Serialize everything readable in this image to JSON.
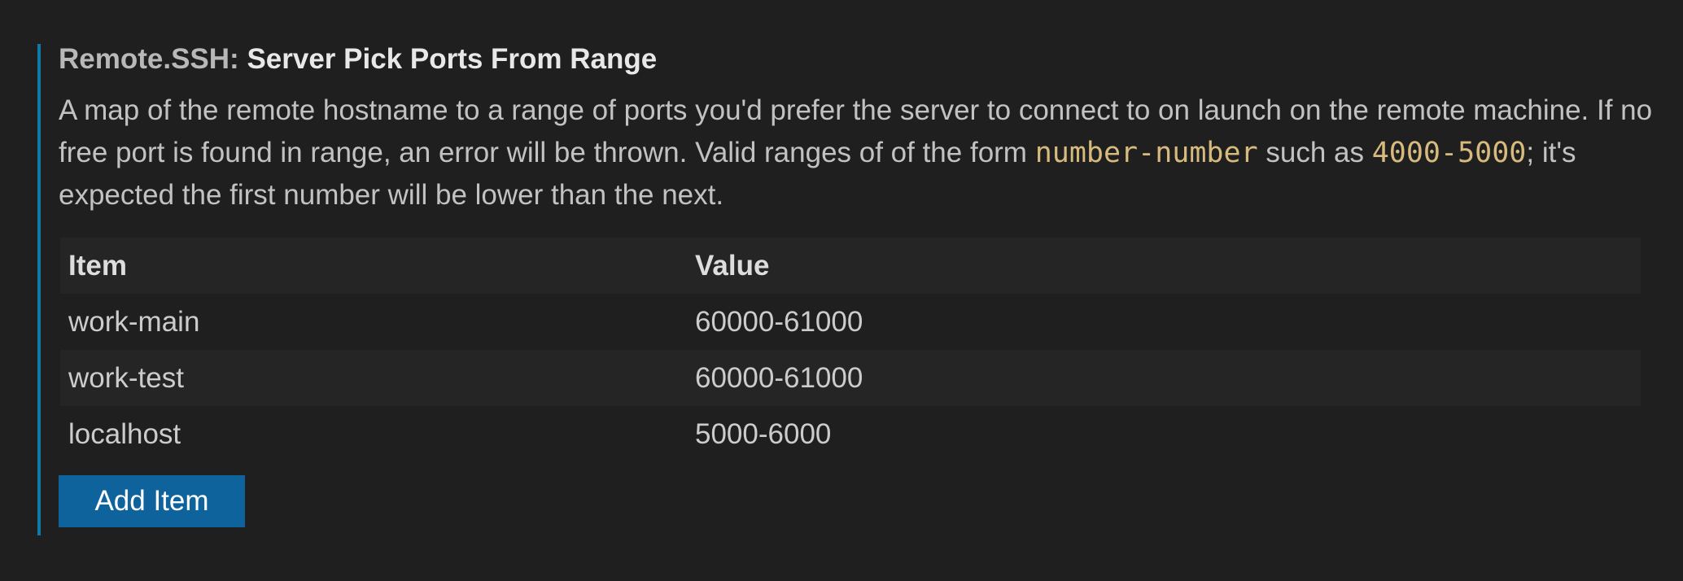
{
  "setting": {
    "category": "Remote.SSH: ",
    "label": "Server Pick Ports From Range",
    "description": {
      "part1": "A map of the remote hostname to a range of ports you'd prefer the server to connect to on launch on the remote machine. If no free port is found in range, an error will be thrown. Valid ranges of of the form ",
      "code1": "number-number",
      "part2": " such as ",
      "code2": "4000-5000",
      "part3": "; it's expected the first number will be lower than the next."
    }
  },
  "table": {
    "headers": {
      "item": "Item",
      "value": "Value"
    },
    "rows": [
      {
        "item": "work-main",
        "value": "60000-61000"
      },
      {
        "item": "work-test",
        "value": "60000-61000"
      },
      {
        "item": "localhost",
        "value": "5000-6000"
      }
    ]
  },
  "add_button_label": "Add Item",
  "colors": {
    "accent_border": "#0e7aa8",
    "button_bg": "#0e639c",
    "code_text": "#d7ba7d",
    "background": "#1f1f1f"
  }
}
